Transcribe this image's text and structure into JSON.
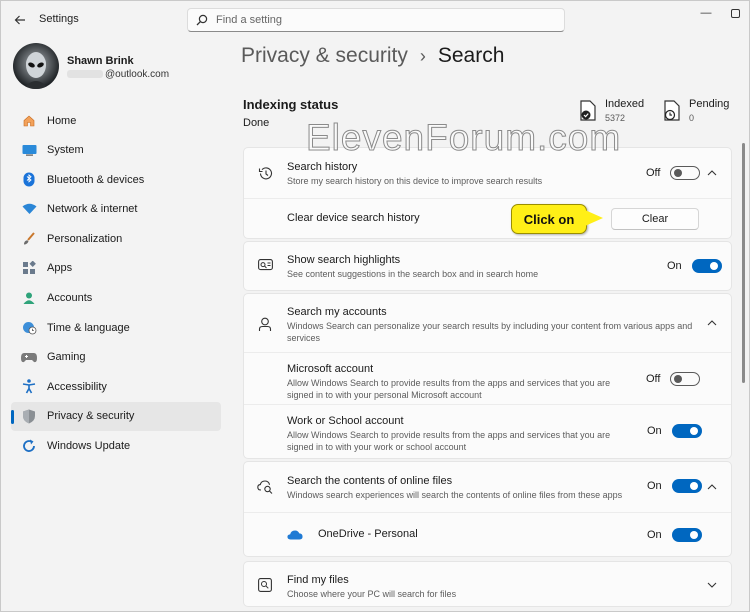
{
  "window": {
    "title": "Settings",
    "min_icon": "minimize-icon",
    "max_icon": "maximize-icon",
    "close_icon": "close-icon"
  },
  "search": {
    "placeholder": "Find a setting"
  },
  "user": {
    "name": "Shawn Brink",
    "email": "@outlook.com"
  },
  "sidebar": {
    "items": [
      {
        "label": "Home",
        "icon": "home-icon"
      },
      {
        "label": "System",
        "icon": "system-icon"
      },
      {
        "label": "Bluetooth & devices",
        "icon": "bluetooth-icon"
      },
      {
        "label": "Network & internet",
        "icon": "wifi-icon"
      },
      {
        "label": "Personalization",
        "icon": "brush-icon"
      },
      {
        "label": "Apps",
        "icon": "apps-icon"
      },
      {
        "label": "Accounts",
        "icon": "accounts-icon"
      },
      {
        "label": "Time & language",
        "icon": "globe-clock-icon"
      },
      {
        "label": "Gaming",
        "icon": "gamepad-icon"
      },
      {
        "label": "Accessibility",
        "icon": "accessibility-icon"
      },
      {
        "label": "Privacy & security",
        "icon": "shield-icon",
        "active": true
      },
      {
        "label": "Windows Update",
        "icon": "update-icon"
      }
    ]
  },
  "header": {
    "parent": "Privacy & security",
    "separator": "›",
    "current": "Search"
  },
  "indexing": {
    "title": "Indexing status",
    "status": "Done",
    "indexed_label": "Indexed",
    "indexed_value": "5372",
    "pending_label": "Pending",
    "pending_value": "0"
  },
  "watermark": "ElevenForum.com",
  "cards": {
    "history": {
      "title": "Search history",
      "desc": "Store my search history on this device to improve search results",
      "toggle": "Off",
      "clear_label": "Clear device search history",
      "clear_button": "Clear"
    },
    "highlights": {
      "title": "Show search highlights",
      "desc": "See content suggestions in the search box and in search home",
      "toggle": "On"
    },
    "accounts": {
      "title": "Search my accounts",
      "desc": "Windows Search can personalize your search results by including your content from various apps and services",
      "microsoft": {
        "title": "Microsoft account",
        "desc": "Allow Windows Search to provide results from the apps and services that you are signed in to with your personal Microsoft account",
        "toggle": "Off"
      },
      "work": {
        "title": "Work or School account",
        "desc": "Allow Windows Search to provide results from the apps and services that you are signed in to with your work or school account",
        "toggle": "On"
      }
    },
    "online": {
      "title": "Search the contents of online files",
      "desc": "Windows search experiences will search the contents of online files from these apps",
      "toggle": "On",
      "onedrive_label": "OneDrive - Personal",
      "onedrive_toggle": "On"
    },
    "find": {
      "title": "Find my files",
      "desc": "Choose where your PC will search for files"
    }
  },
  "callout": {
    "text": "Click on"
  },
  "colors": {
    "accent": "#0067c0",
    "callout": "#ffef17"
  }
}
